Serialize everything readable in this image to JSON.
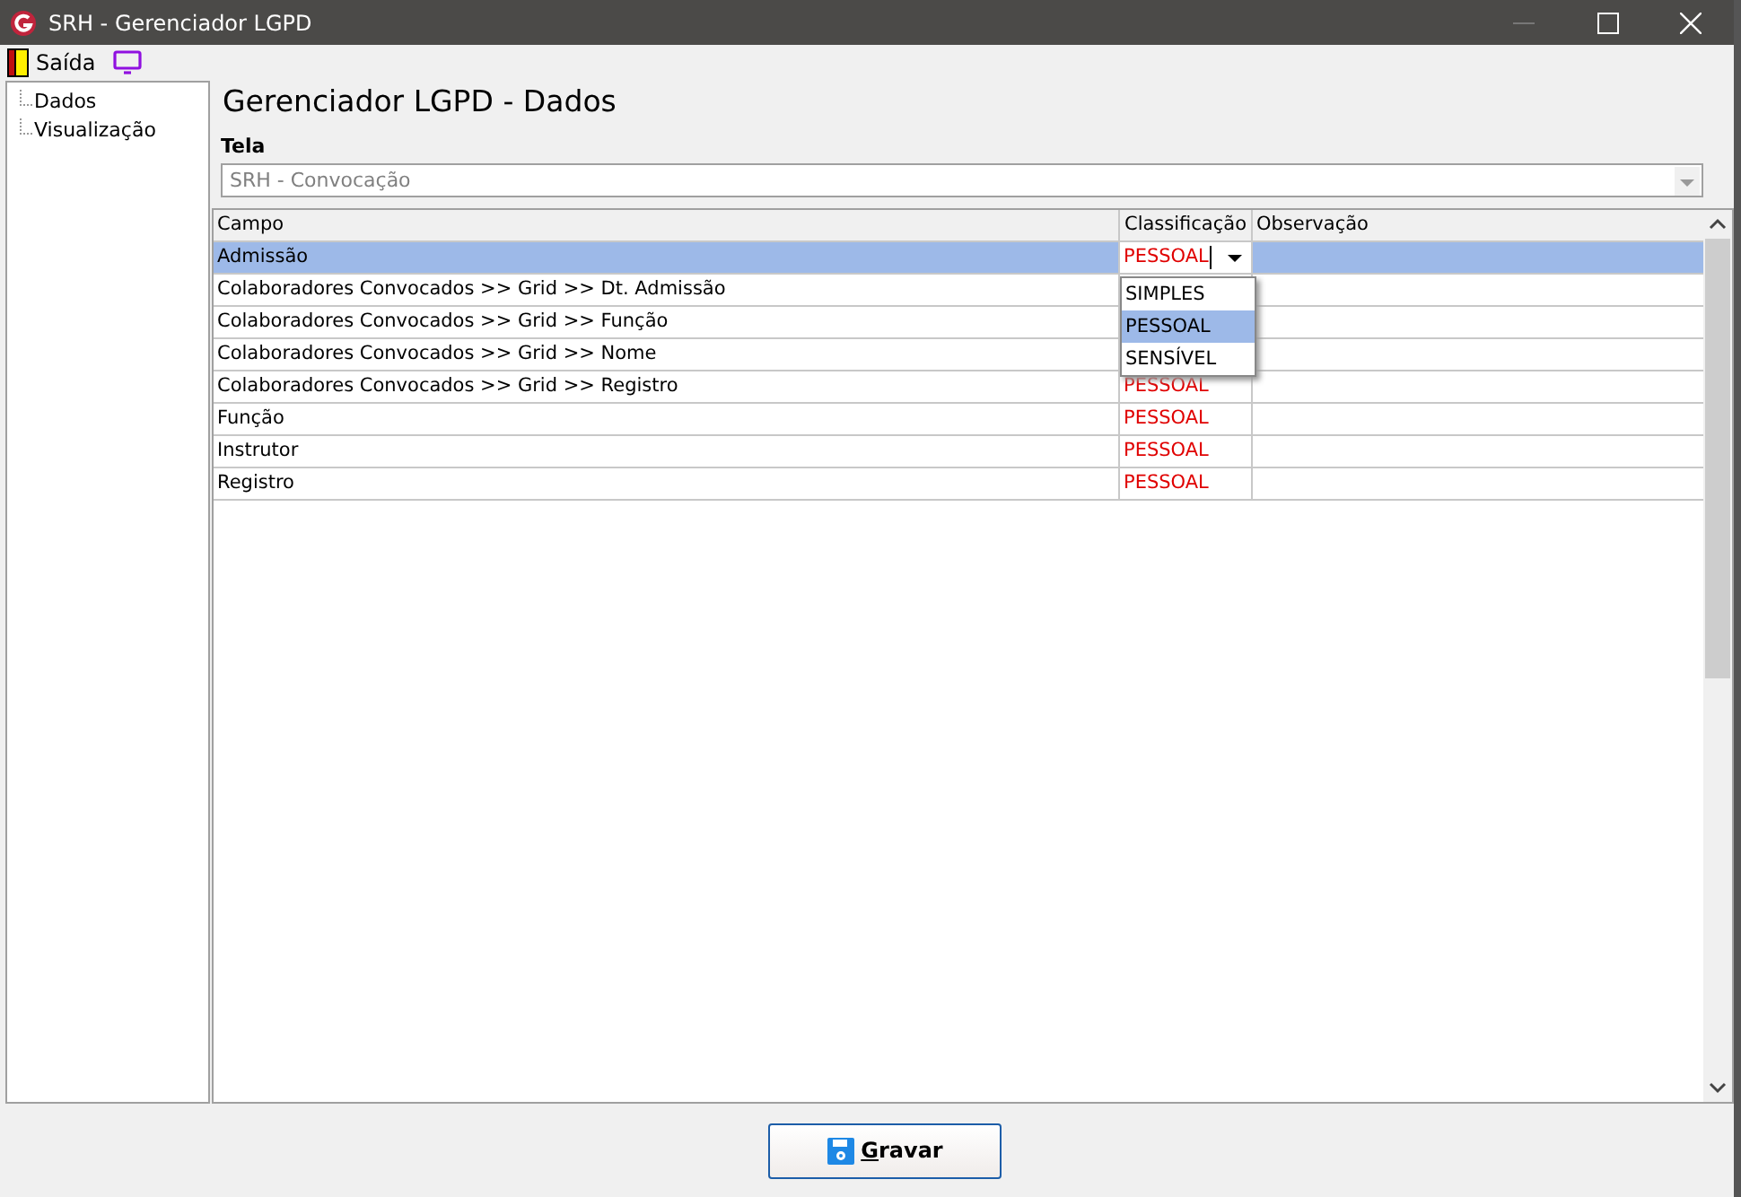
{
  "window": {
    "title": "SRH - Gerenciador LGPD"
  },
  "toolbar": [
    {
      "kind": "exit",
      "label": "Saída"
    },
    {
      "kind": "monitor"
    }
  ],
  "tree": [
    {
      "label": "Dados"
    },
    {
      "label": "Visualização"
    }
  ],
  "heading": "Gerenciador LGPD - Dados",
  "tela": {
    "label": "Tela",
    "value": "SRH - Convocação",
    "disabled": true
  },
  "table": {
    "columns": [
      "Campo",
      "Classificação",
      "Observação"
    ],
    "rows": [
      {
        "campo": "Admissão",
        "classificacao": "PESSOAL",
        "selected": true,
        "editing": true
      },
      {
        "campo": "Colaboradores Convocados >> Grid >> Dt. Admissão",
        "selected": false
      },
      {
        "campo": "Colaboradores Convocados >> Grid >> Função",
        "selected": false
      },
      {
        "campo": "Colaboradores Convocados >> Grid >> Nome",
        "selected": false
      },
      {
        "campo": "Colaboradores Convocados >> Grid >> Registro",
        "classificacao": "PESSOAL",
        "selected": false
      },
      {
        "campo": "Função",
        "classificacao": "PESSOAL",
        "selected": false
      },
      {
        "campo": "Instrutor",
        "classificacao": "PESSOAL",
        "selected": false
      },
      {
        "campo": "Registro",
        "classificacao": "PESSOAL",
        "selected": false
      }
    ],
    "dropdown": [
      {
        "label": "SIMPLES",
        "selected": false
      },
      {
        "label": "PESSOAL",
        "selected": true
      },
      {
        "label": "SENSÍVEL",
        "selected": false
      }
    ]
  },
  "buttons": [
    {
      "label": "Gravar"
    }
  ]
}
